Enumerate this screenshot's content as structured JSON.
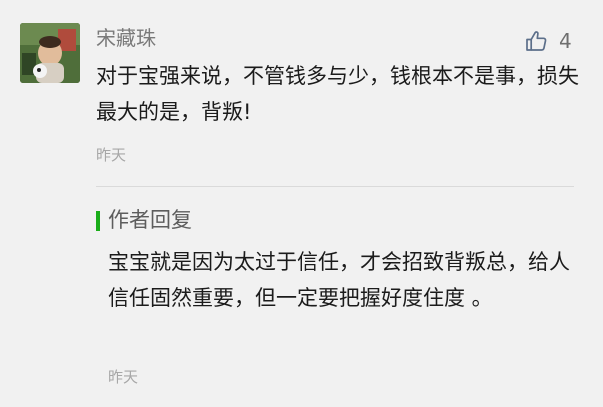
{
  "comment": {
    "author": "宋藏珠",
    "likes": "4",
    "text": "对于宝强来说，不管钱多与少，钱根本不是事，损失最大的是，背叛!",
    "time": "昨天"
  },
  "reply": {
    "label": "作者回复",
    "text": "宝宝就是因为太过于信任，才会招致背叛总，给人信任固然重要，但一定要把握好度住度 。",
    "time": "昨天"
  },
  "icons": {
    "like": "thumbs-up-icon"
  },
  "colors": {
    "background": "#f1f1f1",
    "accent_green": "#1aad19"
  }
}
